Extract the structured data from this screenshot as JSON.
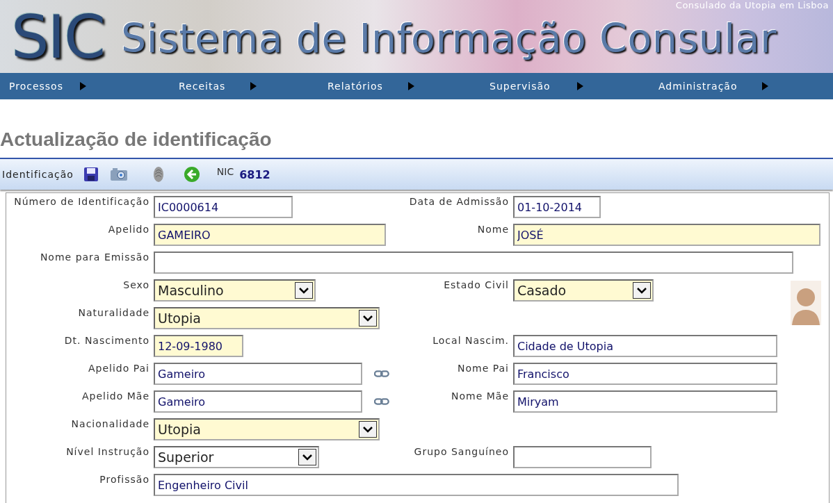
{
  "header": {
    "logo": "SIC",
    "title": "Sistema de Informação Consular",
    "subtitle": "Consulado da Utopia em Lisboa"
  },
  "nav": [
    {
      "label": "Processos"
    },
    {
      "label": "Receitas"
    },
    {
      "label": "Relatórios"
    },
    {
      "label": "Supervisão"
    },
    {
      "label": "Administração"
    }
  ],
  "page_title": "Actualização de identificação",
  "toolbar": {
    "label": "Identificação",
    "nic_label": "NIC",
    "nic_value": "6812"
  },
  "rows": [
    {
      "left": {
        "label": "Número de Identificação",
        "kind": "text",
        "value": "IC0000614",
        "required": false
      },
      "right": {
        "label": "Data de Admissão",
        "kind": "text",
        "value": "01-10-2014",
        "required": false
      }
    },
    {
      "left": {
        "label": "Apelido",
        "kind": "text",
        "value": "GAMEIRO",
        "required": true
      },
      "right": {
        "label": "Nome",
        "kind": "text",
        "value": "JOSÉ",
        "required": true
      }
    },
    {
      "left": {
        "label": "Nome para Emissão",
        "kind": "text",
        "required": false
      }
    },
    {
      "left": {
        "label": "Sexo",
        "kind": "select",
        "value": "Masculino",
        "required": true
      },
      "right": {
        "label": "Estado Civil",
        "kind": "select",
        "value": "Casado",
        "required": true
      }
    },
    {
      "left": {
        "label": "Naturalidade",
        "kind": "select",
        "value": "Utopia",
        "required": true
      }
    },
    {
      "left": {
        "label": "Dt. Nascimento",
        "kind": "text",
        "value": "12-09-1980",
        "required": true
      },
      "right": {
        "label": "Local Nascim.",
        "kind": "text",
        "value": "Cidade de Utopia",
        "required": false
      }
    },
    {
      "left": {
        "label": "Apelido Pai",
        "kind": "text",
        "value": "Gameiro",
        "required": false,
        "linked": true
      },
      "right": {
        "label": "Nome Pai",
        "kind": "text",
        "value": "Francisco",
        "required": false
      }
    },
    {
      "left": {
        "label": "Apelido Mãe",
        "kind": "text",
        "value": "Gameiro",
        "required": false,
        "linked": true
      },
      "right": {
        "label": "Nome Mãe",
        "kind": "text",
        "value": "Miryam",
        "required": false
      }
    },
    {
      "left": {
        "label": "Nacionalidade",
        "kind": "select",
        "value": "Utopia",
        "required": true
      }
    },
    {
      "left": {
        "label": "Nível Instrução",
        "kind": "select",
        "value": "Superior",
        "required": false
      },
      "right": {
        "label": "Grupo Sanguíneo",
        "kind": "text",
        "required": false
      }
    },
    {
      "left": {
        "label": "Profissão",
        "kind": "text",
        "value": "Engenheiro Civil",
        "required": false
      }
    }
  ]
}
